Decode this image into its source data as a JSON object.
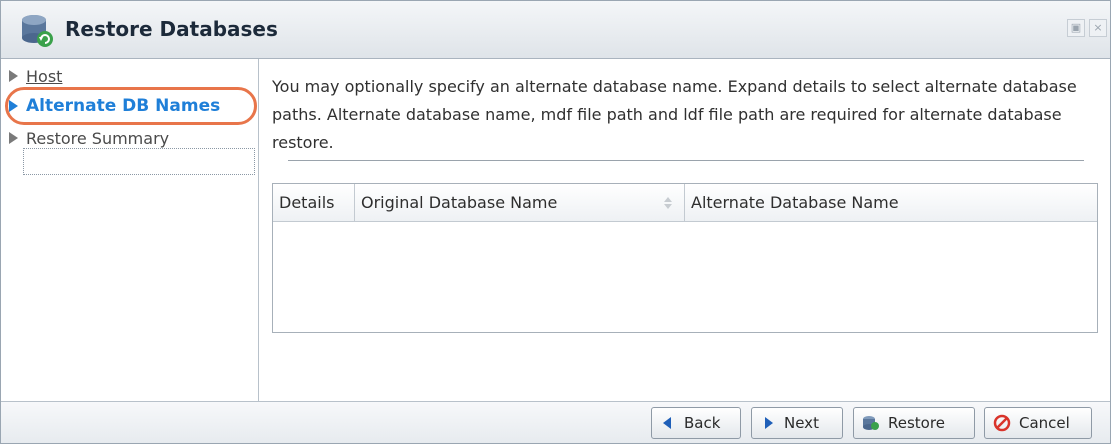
{
  "window": {
    "title": "Restore Databases",
    "controls": [
      "▣",
      "×"
    ]
  },
  "nav": {
    "items": [
      {
        "label": "Host",
        "state": "link",
        "icon": "arrow-right-icon"
      },
      {
        "label": "Alternate DB Names",
        "state": "active",
        "icon": "arrow-right-icon"
      },
      {
        "label": "Restore Summary",
        "state": "normal",
        "icon": "arrow-right-icon"
      }
    ]
  },
  "main": {
    "description": "You may optionally specify an alternate database name. Expand details to select alternate database paths. Alternate database name, mdf file path and ldf file path are required for alternate database restore.",
    "grid": {
      "columns": [
        "Details",
        "Original Database Name",
        "Alternate Database Name"
      ],
      "rows": []
    }
  },
  "footer": {
    "back_label": "Back",
    "next_label": "Next",
    "restore_label": "Restore",
    "cancel_label": "Cancel"
  },
  "colors": {
    "active_nav": "#1f7fd8",
    "highlight_ring": "#e8754a",
    "cancel_icon": "#d9342b",
    "nav_arrow": "#1f5fb8"
  }
}
